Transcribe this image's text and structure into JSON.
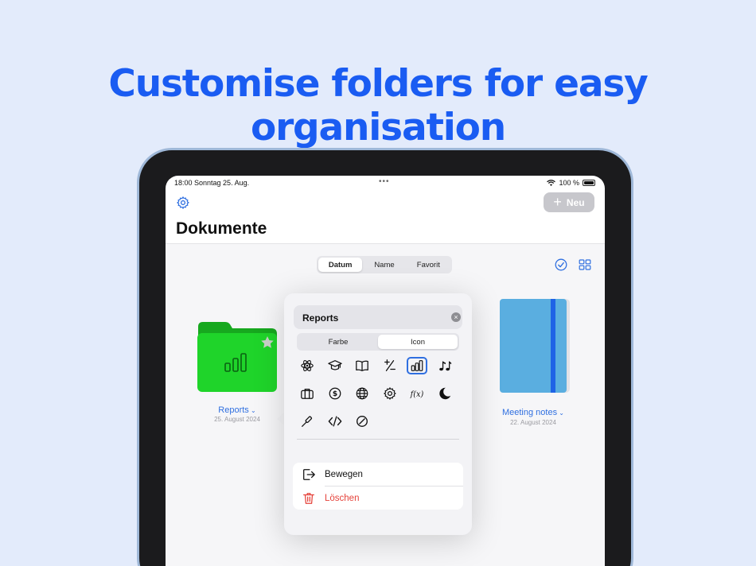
{
  "headline": "Customise folders for easy organisation",
  "status": {
    "time_date": "18:00  Sonntag 25. Aug.",
    "dots": "•••",
    "battery": "100 %"
  },
  "toolbar": {
    "new_label": "Neu"
  },
  "page": {
    "title": "Dokumente"
  },
  "sort": {
    "options": [
      "Datum",
      "Name",
      "Favorit"
    ],
    "selected": "Datum"
  },
  "items": [
    {
      "name": "Reports",
      "date": "25. August 2024",
      "color": "#1fd42a"
    },
    {
      "name": "Meeting notes",
      "date": "22. August 2024",
      "color": "#5aaee0"
    }
  ],
  "popover": {
    "name_value": "Reports",
    "tabs": [
      "Farbe",
      "Icon"
    ],
    "selected_tab": "Icon",
    "icons": [
      "atom-icon",
      "graduation-cap-icon",
      "book-icon",
      "plus-minus-icon",
      "chart-bars-icon",
      "music-notes-icon",
      "briefcase-icon",
      "dollar-icon",
      "globe-icon",
      "gear-icon",
      "function-icon",
      "moon-icon",
      "screwdriver-icon",
      "code-icon",
      "slash-circle-icon"
    ],
    "selected_icon": "chart-bars-icon",
    "actions": [
      {
        "label": "Bewegen",
        "color": "#111111"
      },
      {
        "label": "Löschen",
        "color": "#e5423a"
      }
    ]
  },
  "colors": {
    "accent": "#1a5cf2",
    "link": "#2f6fe0",
    "destructive": "#e5423a"
  }
}
